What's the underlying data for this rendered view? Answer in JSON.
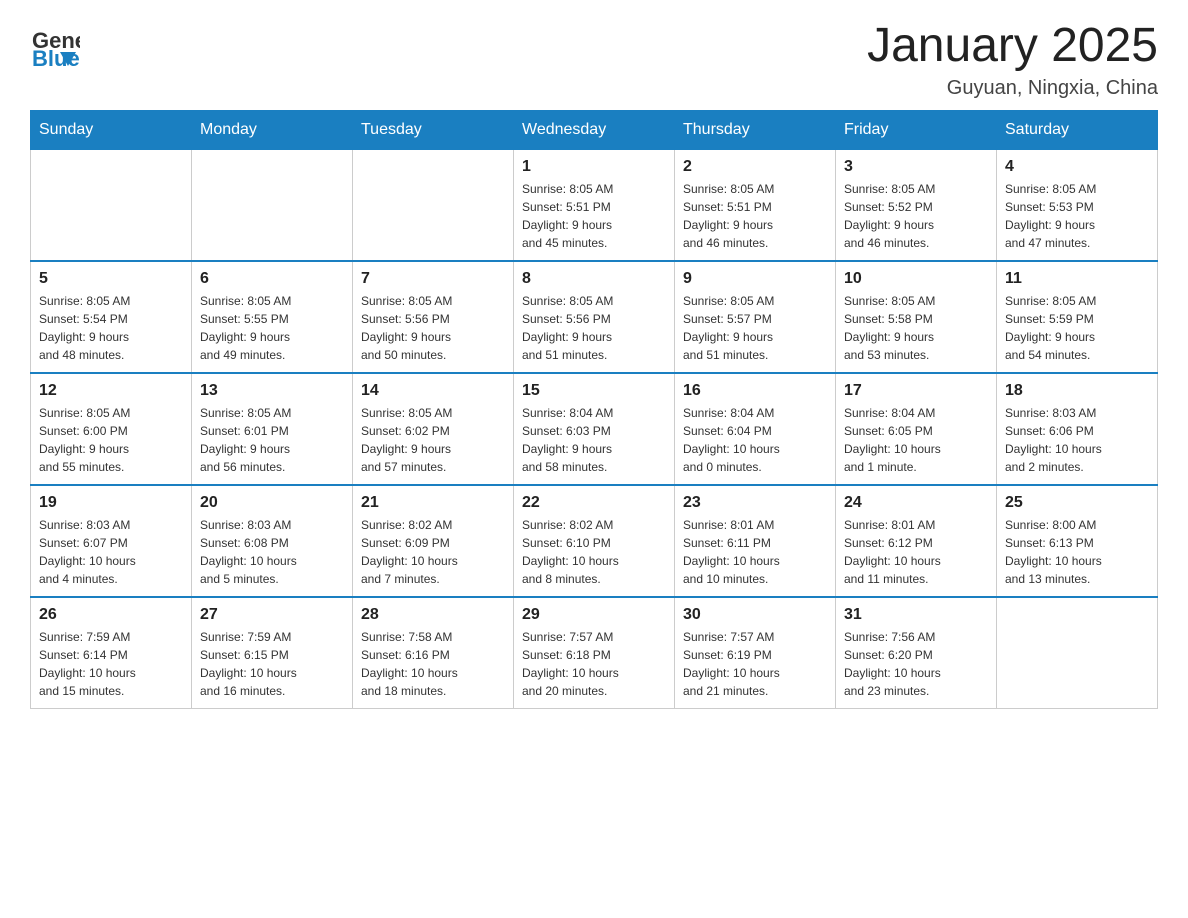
{
  "logo": {
    "text_general": "General",
    "text_blue": "Blue"
  },
  "title": "January 2025",
  "subtitle": "Guyuan, Ningxia, China",
  "weekdays": [
    "Sunday",
    "Monday",
    "Tuesday",
    "Wednesday",
    "Thursday",
    "Friday",
    "Saturday"
  ],
  "weeks": [
    [
      {
        "day": "",
        "info": ""
      },
      {
        "day": "",
        "info": ""
      },
      {
        "day": "",
        "info": ""
      },
      {
        "day": "1",
        "info": "Sunrise: 8:05 AM\nSunset: 5:51 PM\nDaylight: 9 hours\nand 45 minutes."
      },
      {
        "day": "2",
        "info": "Sunrise: 8:05 AM\nSunset: 5:51 PM\nDaylight: 9 hours\nand 46 minutes."
      },
      {
        "day": "3",
        "info": "Sunrise: 8:05 AM\nSunset: 5:52 PM\nDaylight: 9 hours\nand 46 minutes."
      },
      {
        "day": "4",
        "info": "Sunrise: 8:05 AM\nSunset: 5:53 PM\nDaylight: 9 hours\nand 47 minutes."
      }
    ],
    [
      {
        "day": "5",
        "info": "Sunrise: 8:05 AM\nSunset: 5:54 PM\nDaylight: 9 hours\nand 48 minutes."
      },
      {
        "day": "6",
        "info": "Sunrise: 8:05 AM\nSunset: 5:55 PM\nDaylight: 9 hours\nand 49 minutes."
      },
      {
        "day": "7",
        "info": "Sunrise: 8:05 AM\nSunset: 5:56 PM\nDaylight: 9 hours\nand 50 minutes."
      },
      {
        "day": "8",
        "info": "Sunrise: 8:05 AM\nSunset: 5:56 PM\nDaylight: 9 hours\nand 51 minutes."
      },
      {
        "day": "9",
        "info": "Sunrise: 8:05 AM\nSunset: 5:57 PM\nDaylight: 9 hours\nand 51 minutes."
      },
      {
        "day": "10",
        "info": "Sunrise: 8:05 AM\nSunset: 5:58 PM\nDaylight: 9 hours\nand 53 minutes."
      },
      {
        "day": "11",
        "info": "Sunrise: 8:05 AM\nSunset: 5:59 PM\nDaylight: 9 hours\nand 54 minutes."
      }
    ],
    [
      {
        "day": "12",
        "info": "Sunrise: 8:05 AM\nSunset: 6:00 PM\nDaylight: 9 hours\nand 55 minutes."
      },
      {
        "day": "13",
        "info": "Sunrise: 8:05 AM\nSunset: 6:01 PM\nDaylight: 9 hours\nand 56 minutes."
      },
      {
        "day": "14",
        "info": "Sunrise: 8:05 AM\nSunset: 6:02 PM\nDaylight: 9 hours\nand 57 minutes."
      },
      {
        "day": "15",
        "info": "Sunrise: 8:04 AM\nSunset: 6:03 PM\nDaylight: 9 hours\nand 58 minutes."
      },
      {
        "day": "16",
        "info": "Sunrise: 8:04 AM\nSunset: 6:04 PM\nDaylight: 10 hours\nand 0 minutes."
      },
      {
        "day": "17",
        "info": "Sunrise: 8:04 AM\nSunset: 6:05 PM\nDaylight: 10 hours\nand 1 minute."
      },
      {
        "day": "18",
        "info": "Sunrise: 8:03 AM\nSunset: 6:06 PM\nDaylight: 10 hours\nand 2 minutes."
      }
    ],
    [
      {
        "day": "19",
        "info": "Sunrise: 8:03 AM\nSunset: 6:07 PM\nDaylight: 10 hours\nand 4 minutes."
      },
      {
        "day": "20",
        "info": "Sunrise: 8:03 AM\nSunset: 6:08 PM\nDaylight: 10 hours\nand 5 minutes."
      },
      {
        "day": "21",
        "info": "Sunrise: 8:02 AM\nSunset: 6:09 PM\nDaylight: 10 hours\nand 7 minutes."
      },
      {
        "day": "22",
        "info": "Sunrise: 8:02 AM\nSunset: 6:10 PM\nDaylight: 10 hours\nand 8 minutes."
      },
      {
        "day": "23",
        "info": "Sunrise: 8:01 AM\nSunset: 6:11 PM\nDaylight: 10 hours\nand 10 minutes."
      },
      {
        "day": "24",
        "info": "Sunrise: 8:01 AM\nSunset: 6:12 PM\nDaylight: 10 hours\nand 11 minutes."
      },
      {
        "day": "25",
        "info": "Sunrise: 8:00 AM\nSunset: 6:13 PM\nDaylight: 10 hours\nand 13 minutes."
      }
    ],
    [
      {
        "day": "26",
        "info": "Sunrise: 7:59 AM\nSunset: 6:14 PM\nDaylight: 10 hours\nand 15 minutes."
      },
      {
        "day": "27",
        "info": "Sunrise: 7:59 AM\nSunset: 6:15 PM\nDaylight: 10 hours\nand 16 minutes."
      },
      {
        "day": "28",
        "info": "Sunrise: 7:58 AM\nSunset: 6:16 PM\nDaylight: 10 hours\nand 18 minutes."
      },
      {
        "day": "29",
        "info": "Sunrise: 7:57 AM\nSunset: 6:18 PM\nDaylight: 10 hours\nand 20 minutes."
      },
      {
        "day": "30",
        "info": "Sunrise: 7:57 AM\nSunset: 6:19 PM\nDaylight: 10 hours\nand 21 minutes."
      },
      {
        "day": "31",
        "info": "Sunrise: 7:56 AM\nSunset: 6:20 PM\nDaylight: 10 hours\nand 23 minutes."
      },
      {
        "day": "",
        "info": ""
      }
    ]
  ]
}
